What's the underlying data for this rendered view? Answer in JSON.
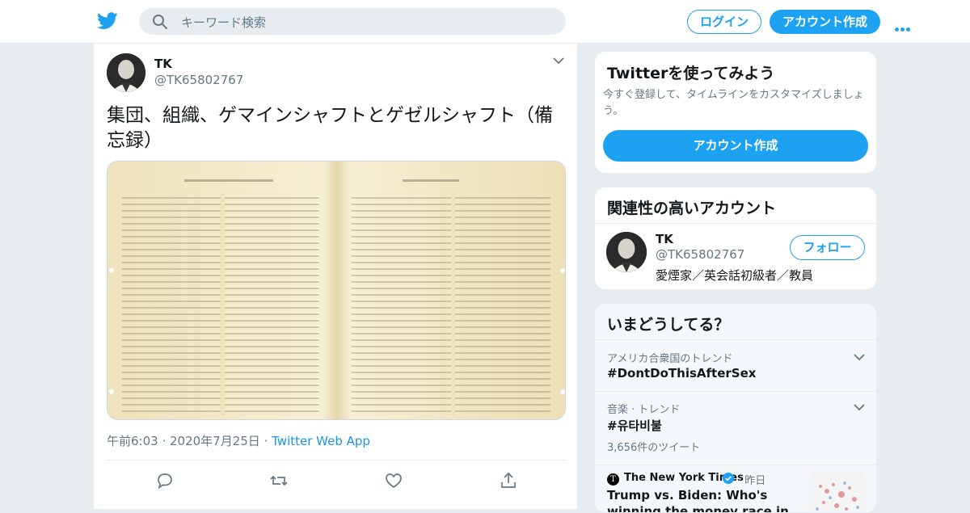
{
  "header": {
    "search_placeholder": "キーワード検索",
    "login_label": "ログイン",
    "signup_label": "アカウント作成"
  },
  "tweet": {
    "author_name": "TK",
    "author_handle": "@TK65802767",
    "text": "集団、組織、ゲマインシャフトとゲゼルシャフト（備忘録）",
    "time": "午前6:03",
    "date": "2020年7月25日",
    "source": "Twitter Web App"
  },
  "sidebar": {
    "try_title": "Twitterを使ってみよう",
    "try_desc": "今すぐ登録して、タイムラインをカスタマイズしましょう。",
    "try_button": "アカウント作成",
    "related_title": "関連性の高いアカウント",
    "related": {
      "name": "TK",
      "handle": "@TK65802767",
      "bio": "愛煙家／英会話初級者／教員",
      "follow_label": "フォロー"
    },
    "trends_title": "いまどうしてる？",
    "trends": [
      {
        "context": "アメリカ合衆国のトレンド",
        "title": "#DontDoThisAfterSex",
        "count": ""
      },
      {
        "context": "音楽 · トレンド",
        "title": "#유타비불",
        "count": "3,656件のツイート"
      }
    ],
    "news": {
      "source": "The New York Times",
      "time": "· 昨日",
      "headline": "Trump vs. Biden: Who's winning the money race in your ZIP code?"
    }
  },
  "colors": {
    "brand": "#1da1f2",
    "background": "#e6ecf0",
    "secondary_text": "#657786"
  }
}
